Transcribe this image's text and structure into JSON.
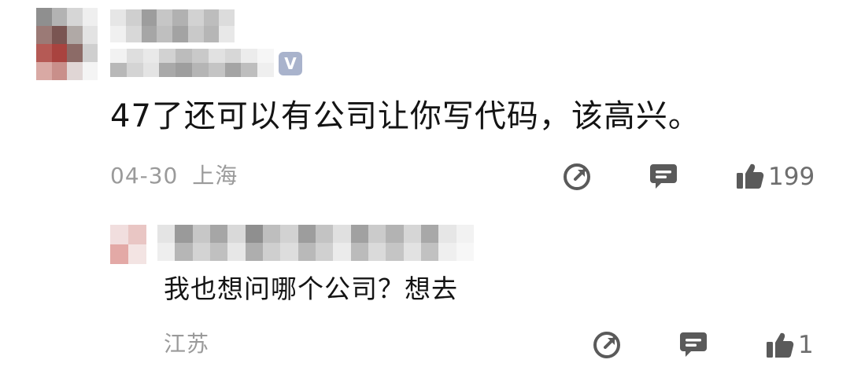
{
  "comment": {
    "text": "47了还可以有公司让你写代码，该高兴。",
    "date": "04-30",
    "location": "上海",
    "likes": "199",
    "share_icon": "share-icon",
    "reply_icon": "reply-icon",
    "like_icon": "thumbs-up-icon"
  },
  "reply": {
    "text": "我也想问哪个公司？想去",
    "location": "江苏",
    "likes": "1"
  },
  "colors": {
    "text": "#141414",
    "meta": "#9a9a9a",
    "icon": "#5a5a5a",
    "verified_badge": "#a9b3cc"
  }
}
